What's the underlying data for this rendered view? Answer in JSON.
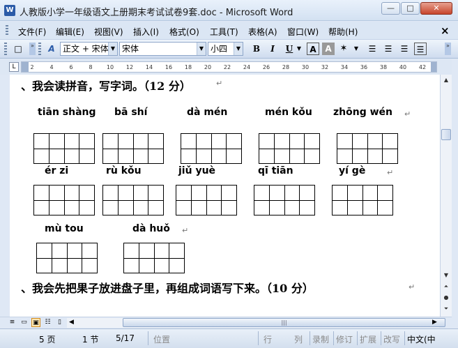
{
  "window": {
    "title": "人教版小学一年级语文上册期末考试试卷9套.doc - Microsoft Word",
    "app_icon": "W",
    "min": "—",
    "max": "□",
    "close": "✕"
  },
  "menu": {
    "items": [
      "文件(F)",
      "编辑(E)",
      "视图(V)",
      "插入(I)",
      "格式(O)",
      "工具(T)",
      "表格(A)",
      "窗口(W)",
      "帮助(H)"
    ],
    "close_doc": "×"
  },
  "toolbar": {
    "style": "正文 + 宋体",
    "font": "宋体",
    "size": "小四",
    "bold": "B",
    "italic": "I",
    "underline": "U",
    "char_border": "A",
    "char_shading": "A",
    "new": "□",
    "styles_icon": "A"
  },
  "ruler": {
    "corner": "L",
    "numbers": [
      "2",
      "4",
      "6",
      "8",
      "10",
      "12",
      "14",
      "16",
      "18",
      "20",
      "22",
      "24",
      "26",
      "28",
      "30",
      "32",
      "34",
      "36",
      "38",
      "40",
      "42"
    ]
  },
  "document": {
    "heading1": "、我会读拼音，写字词。（12 分）",
    "heading2": "、我会先把果子放进盘子里，再组成词语写下来。（10 分）",
    "para_mark": "↵",
    "row1": [
      "tiān shàng",
      "bā  shí",
      "dà  mén",
      "mén kǒu",
      "zhōng  wén"
    ],
    "row2": [
      "ér   zi",
      "rù   kǒu",
      "jiǔ   yuè",
      "qī    tiān",
      "yí    gè"
    ],
    "row3": [
      "mù    tou",
      "dà    huǒ"
    ]
  },
  "status": {
    "page": "5 页",
    "section": "1 节",
    "pages": "5/17",
    "position": "位置",
    "line": "行",
    "column": "列",
    "rec": "录制",
    "trk": "修订",
    "ext": "扩展",
    "ovr": "改写",
    "lang": "中文(中"
  }
}
